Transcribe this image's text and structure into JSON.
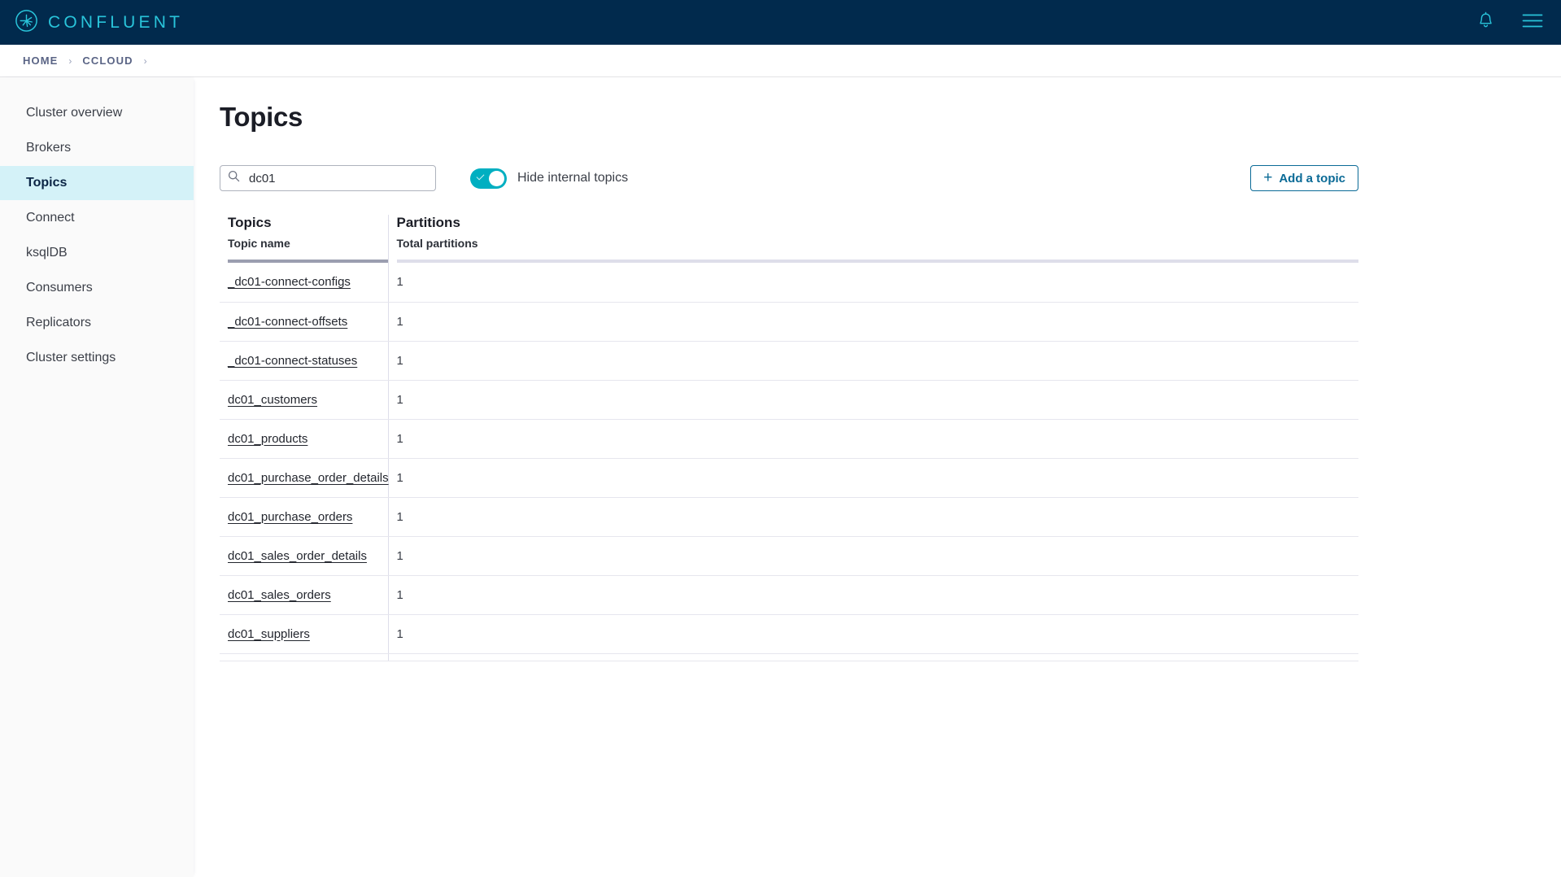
{
  "topnav": {
    "brand_name": "CONFLUENT",
    "logo_icon": "confluent-logo-icon",
    "notifications_icon": "bell-icon",
    "menu_icon": "hamburger-menu-icon",
    "bg_color": "#012a4d",
    "accent_color": "#29c4da"
  },
  "breadcrumb": {
    "items": [
      {
        "label": "HOME"
      },
      {
        "label": "CCLOUD"
      }
    ],
    "separator": "›"
  },
  "sidebar": {
    "items": [
      {
        "label": "Cluster overview",
        "active": false
      },
      {
        "label": "Brokers",
        "active": false
      },
      {
        "label": "Topics",
        "active": true
      },
      {
        "label": "Connect",
        "active": false
      },
      {
        "label": "ksqlDB",
        "active": false
      },
      {
        "label": "Consumers",
        "active": false
      },
      {
        "label": "Replicators",
        "active": false
      },
      {
        "label": "Cluster settings",
        "active": false
      }
    ],
    "active_bg_color": "#d4f2f8"
  },
  "main": {
    "page_title": "Topics",
    "search": {
      "icon": "search-icon",
      "value": "dc01",
      "placeholder": "Search"
    },
    "hide_internal_toggle": {
      "label": "Hide internal topics",
      "state": "on",
      "on_color": "#00afc1",
      "check_icon": "checkmark-icon"
    },
    "add_topic_button": {
      "label": "Add a topic",
      "icon": "plus-icon",
      "color": "#0a6a96"
    },
    "table": {
      "column_groups": [
        {
          "title": "Topics",
          "subtitle": "Topic name"
        },
        {
          "title": "Partitions",
          "subtitle": "Total partitions"
        }
      ],
      "rows": [
        {
          "topic_name": "_dc01-connect-configs",
          "total_partitions": "1"
        },
        {
          "topic_name": "_dc01-connect-offsets",
          "total_partitions": "1"
        },
        {
          "topic_name": "_dc01-connect-statuses",
          "total_partitions": "1"
        },
        {
          "topic_name": "dc01_customers",
          "total_partitions": "1"
        },
        {
          "topic_name": "dc01_products",
          "total_partitions": "1"
        },
        {
          "topic_name": "dc01_purchase_order_details",
          "total_partitions": "1"
        },
        {
          "topic_name": "dc01_purchase_orders",
          "total_partitions": "1"
        },
        {
          "topic_name": "dc01_sales_order_details",
          "total_partitions": "1"
        },
        {
          "topic_name": "dc01_sales_orders",
          "total_partitions": "1"
        },
        {
          "topic_name": "dc01_suppliers",
          "total_partitions": "1"
        }
      ]
    }
  }
}
